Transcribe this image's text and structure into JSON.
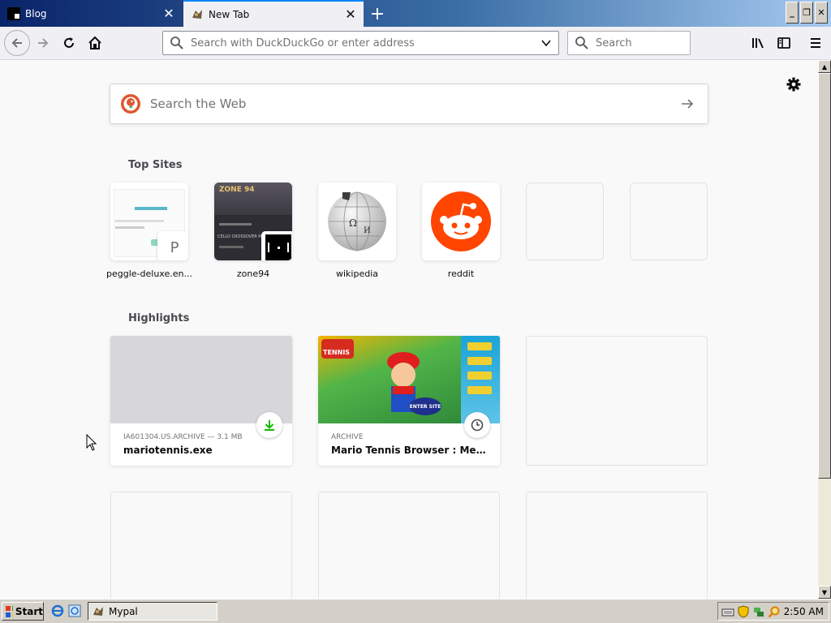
{
  "window": {
    "tabs": [
      {
        "title": "Blog",
        "active": false
      },
      {
        "title": "New Tab",
        "active": true
      }
    ],
    "new_tab_label": "+",
    "controls": {
      "minimize": "_",
      "restore": "❐",
      "close": "✕"
    }
  },
  "toolbar": {
    "url_placeholder": "Search with DuckDuckGo or enter address",
    "search_placeholder": "Search"
  },
  "newtab": {
    "web_search_placeholder": "Search the Web",
    "top_sites_title": "Top Sites",
    "top_sites": [
      {
        "label": "peggle-deluxe.en...",
        "badge": "P"
      },
      {
        "label": "zone94"
      },
      {
        "label": "wikipedia"
      },
      {
        "label": "reddit"
      }
    ],
    "highlights_title": "Highlights",
    "highlights": [
      {
        "meta": "IA601304.US.ARCHIVE — 3.1 MB",
        "title": "mariotennis.exe"
      },
      {
        "meta": "ARCHIVE",
        "title": "Mario Tennis Browser : MediaBr..."
      }
    ],
    "thumb_texts": {
      "zone94": "ZONE 94",
      "zone94_sub": "CELLO CROSSOVER MUSIC",
      "mario_logo": "TENNIS",
      "enter_site": "ENTER SITE"
    }
  },
  "taskbar": {
    "start_label": "Start",
    "task_label": "Mypal",
    "clock": "2:50 AM"
  },
  "colors": {
    "accent": "#0a84ff",
    "reddit": "#ff4500",
    "download_green": "#12bc00"
  }
}
